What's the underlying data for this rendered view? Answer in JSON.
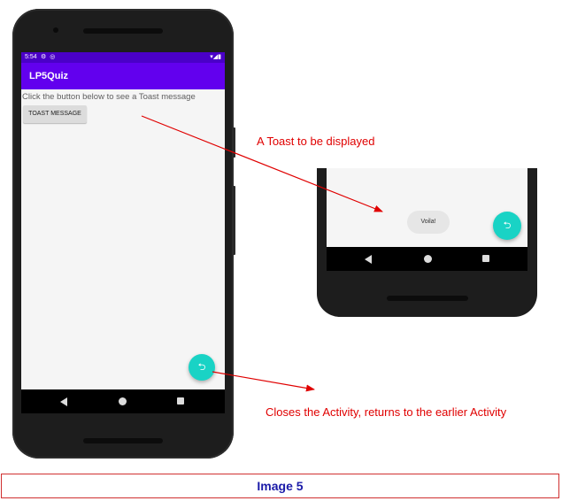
{
  "phone": {
    "status_time": "5:54",
    "status_left_icons": "⚙ ◎",
    "status_right_icons": "▾◢▮",
    "app_title": "LP5Quiz",
    "hint_text": "Click the button below to see a Toast message",
    "toast_button_label": "TOAST MESSAGE",
    "fab_icon": "return-icon",
    "fab_glyph": "⮌"
  },
  "inset": {
    "toast_text": "Voila!",
    "fab_glyph": "⮌"
  },
  "annotations": {
    "toast_label": "A Toast to be displayed",
    "fab_label": "Closes the Activity, returns to the earlier Activity",
    "color": "#e00000"
  },
  "caption": "Image 5",
  "colors": {
    "status_bar": "#4a00c8",
    "app_bar": "#6200ee",
    "fab": "#19d3c5",
    "caption_text": "#1a1aa8",
    "caption_border": "#d03030"
  }
}
